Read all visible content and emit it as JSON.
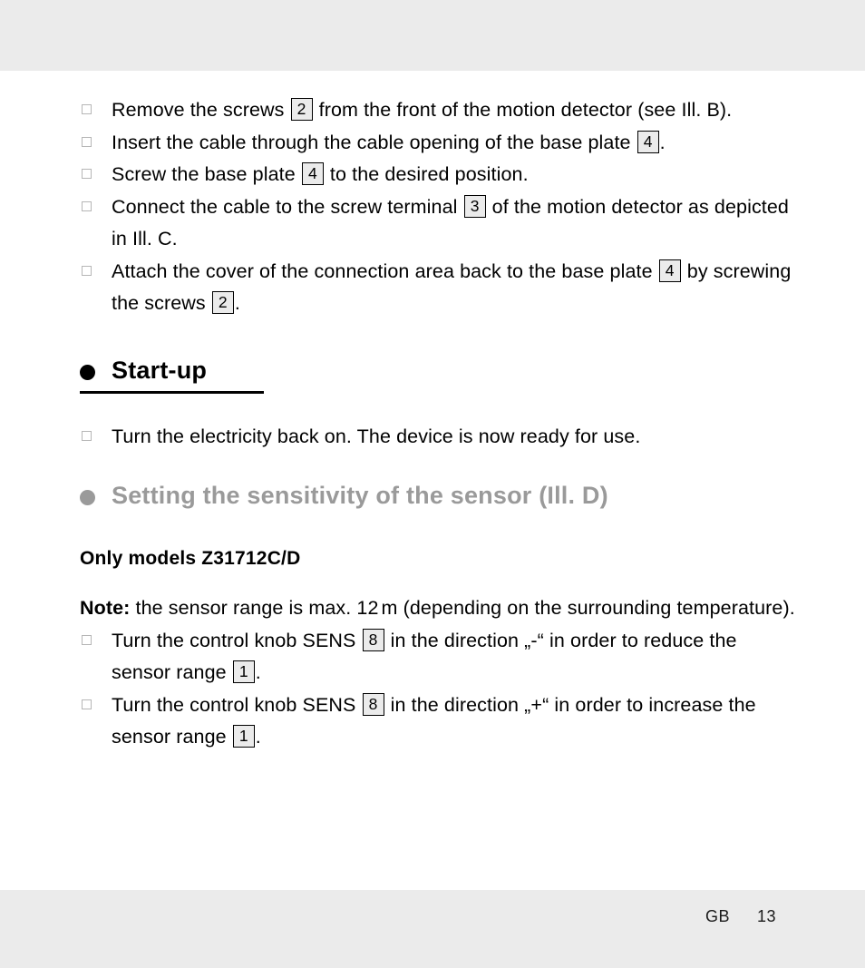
{
  "page": {
    "band_color": "#ebebeb",
    "text_color": "#000000",
    "muted_color": "#9a9a9a"
  },
  "steps_install": [
    {
      "parts": [
        {
          "t": "text",
          "v": "Remove the screws "
        },
        {
          "t": "ref",
          "v": "2"
        },
        {
          "t": "text",
          "v": " from the front of the motion detector (see Ill. B)."
        }
      ]
    },
    {
      "parts": [
        {
          "t": "text",
          "v": "Insert the cable through the cable opening of the base plate "
        },
        {
          "t": "ref",
          "v": "4"
        },
        {
          "t": "text",
          "v": "."
        }
      ]
    },
    {
      "parts": [
        {
          "t": "text",
          "v": "Screw the base plate "
        },
        {
          "t": "ref",
          "v": "4"
        },
        {
          "t": "text",
          "v": " to the desired position."
        }
      ]
    },
    {
      "parts": [
        {
          "t": "text",
          "v": "Connect the cable to the screw terminal "
        },
        {
          "t": "ref",
          "v": "3"
        },
        {
          "t": "text",
          "v": " of the motion detector as depicted in Ill. C."
        }
      ]
    },
    {
      "parts": [
        {
          "t": "text",
          "v": "Attach the cover of the connection area back to the base plate "
        },
        {
          "t": "ref",
          "v": "4"
        },
        {
          "t": "text",
          "v": " by screwing the screws "
        },
        {
          "t": "ref",
          "v": "2"
        },
        {
          "t": "text",
          "v": "."
        }
      ]
    }
  ],
  "heading_startup": {
    "label": "Start-up",
    "bullet": "filled-circle-bullet",
    "color": "#000000",
    "underlined": true
  },
  "steps_startup": [
    {
      "parts": [
        {
          "t": "text",
          "v": "Turn the electricity back on. The device is now ready for use."
        }
      ]
    }
  ],
  "heading_sensitivity": {
    "label": "Setting the sensitivity of the sensor (Ill. D)",
    "bullet": "filled-circle-bullet",
    "color": "#9a9a9a",
    "underlined": false
  },
  "subheading_models": {
    "label": "Only models Z31712C/D"
  },
  "note": {
    "label": "Note:",
    "body": " the sensor range is max. 12",
    "unit": "m",
    "body_tail": " (depending on the surrounding temperature)."
  },
  "steps_sensitivity": [
    {
      "parts": [
        {
          "t": "text",
          "v": "Turn the control knob SENS "
        },
        {
          "t": "ref",
          "v": "8"
        },
        {
          "t": "text",
          "v": " in the direction „-“ in order to reduce the sensor range "
        },
        {
          "t": "ref",
          "v": "1"
        },
        {
          "t": "text",
          "v": "."
        }
      ]
    },
    {
      "parts": [
        {
          "t": "text",
          "v": "Turn the control knob SENS "
        },
        {
          "t": "ref",
          "v": "8"
        },
        {
          "t": "text",
          "v": " in the direction „+“ in order to increase the sensor range "
        },
        {
          "t": "ref",
          "v": "1"
        },
        {
          "t": "text",
          "v": "."
        }
      ]
    }
  ],
  "footer": {
    "language": "GB",
    "page_number": "13"
  }
}
